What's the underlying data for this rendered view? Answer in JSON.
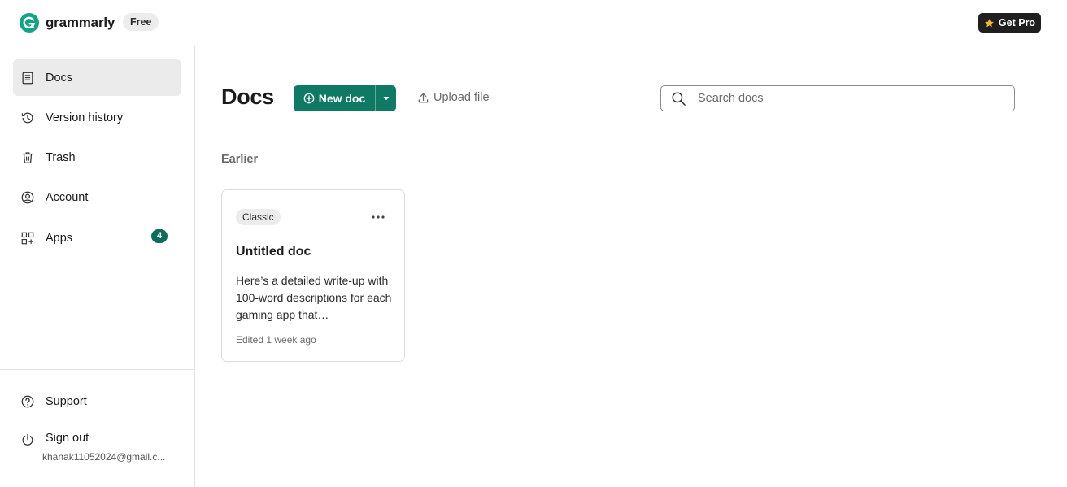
{
  "header": {
    "brand": "grammarly",
    "plan_badge": "Free",
    "get_pro_label": "Get Pro"
  },
  "sidebar": {
    "items": [
      {
        "label": "Docs",
        "icon": "document-icon",
        "active": true
      },
      {
        "label": "Version history",
        "icon": "history-icon"
      },
      {
        "label": "Trash",
        "icon": "trash-icon"
      },
      {
        "label": "Account",
        "icon": "account-icon"
      },
      {
        "label": "Apps",
        "icon": "apps-icon",
        "badge": "4"
      }
    ],
    "bottom": {
      "support_label": "Support",
      "signout_label": "Sign out",
      "email": "khanak11052024@gmail.c..."
    }
  },
  "main": {
    "title": "Docs",
    "new_doc_label": "New doc",
    "upload_label": "Upload file",
    "search_placeholder": "Search docs",
    "section_label": "Earlier",
    "docs": [
      {
        "type": "Classic",
        "title": "Untitled doc",
        "preview": "Here’s a detailed write-up with 100-word descriptions for each gaming app that…",
        "edited": "Edited 1 week ago"
      }
    ]
  },
  "colors": {
    "brand_green": "#0e7a64",
    "badge_green": "#0e6d5a",
    "active_bg": "#ebebeb",
    "star": "#f5b82e"
  }
}
